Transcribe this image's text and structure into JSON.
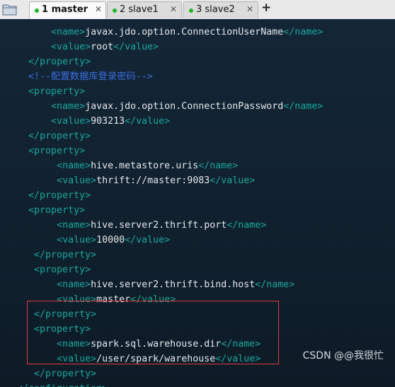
{
  "tabs": [
    {
      "label": "1 master",
      "active": true
    },
    {
      "label": "2 slave1",
      "active": false
    },
    {
      "label": "3 slave2",
      "active": false
    }
  ],
  "colors": {
    "tag": "#1aa89c",
    "text": "#e3e8ee",
    "comment": "#3a6fe0",
    "highlight_border": "#e03a3a",
    "tab_dot": "#1fb81f"
  },
  "icons": {
    "folder": "folder-icon",
    "close": "close-icon",
    "new_tab": "plus-icon"
  },
  "lines": [
    {
      "indent": "        ",
      "open": "<name>",
      "text": "javax.jdo.option.ConnectionUserName",
      "close": "</name>"
    },
    {
      "indent": "        ",
      "open": "<value>",
      "text": "root",
      "close": "</value>"
    },
    {
      "indent": "    ",
      "open": "</property>",
      "text": "",
      "close": ""
    },
    {
      "indent": "    ",
      "comment": "<!--配置数据库登录密码-->"
    },
    {
      "indent": "    ",
      "open": "<property>",
      "text": "",
      "close": ""
    },
    {
      "indent": "        ",
      "open": "<name>",
      "text": "javax.jdo.option.ConnectionPassword",
      "close": "</name>"
    },
    {
      "indent": "        ",
      "open": "<value>",
      "text": "903213",
      "close": "</value>"
    },
    {
      "indent": "    ",
      "open": "</property>",
      "text": "",
      "close": ""
    },
    {
      "indent": "    ",
      "open": "<property>",
      "text": "",
      "close": ""
    },
    {
      "indent": "         ",
      "open": "<name>",
      "text": "hive.metastore.uris",
      "close": "</name>"
    },
    {
      "indent": "         ",
      "open": "<value>",
      "text": "thrift://master:9083",
      "close": "</value>"
    },
    {
      "indent": "    ",
      "open": "</property>",
      "text": "",
      "close": ""
    },
    {
      "indent": "    ",
      "open": "<property>",
      "text": "",
      "close": ""
    },
    {
      "indent": "         ",
      "open": "<name>",
      "text": "hive.server2.thrift.port",
      "close": "</name>"
    },
    {
      "indent": "         ",
      "open": "<value>",
      "text": "10000",
      "close": "</value>"
    },
    {
      "indent": "     ",
      "open": "</property>",
      "text": "",
      "close": ""
    },
    {
      "indent": "     ",
      "open": "<property>",
      "text": "",
      "close": ""
    },
    {
      "indent": "         ",
      "open": "<name>",
      "text": "hive.server2.thrift.bind.host",
      "close": "</name>"
    },
    {
      "indent": "         ",
      "open": "<value>",
      "text": "master",
      "close": "</value>"
    },
    {
      "indent": "     ",
      "open": "</property>",
      "text": "",
      "close": ""
    },
    {
      "indent": "     ",
      "open": "<property>",
      "text": "",
      "close": ""
    },
    {
      "indent": "         ",
      "open": "<name>",
      "text": "spark.sql.warehouse.dir",
      "close": "</name>"
    },
    {
      "indent": "         ",
      "open": "<value>",
      "text": "/user/spark/warehouse",
      "close": "</value>"
    },
    {
      "indent": "     ",
      "open": "</property>",
      "text": "",
      "close": ""
    },
    {
      "indent": "  ",
      "open": "</configuration>",
      "text": "",
      "close": ""
    }
  ],
  "watermark": "CSDN @@我很忙"
}
